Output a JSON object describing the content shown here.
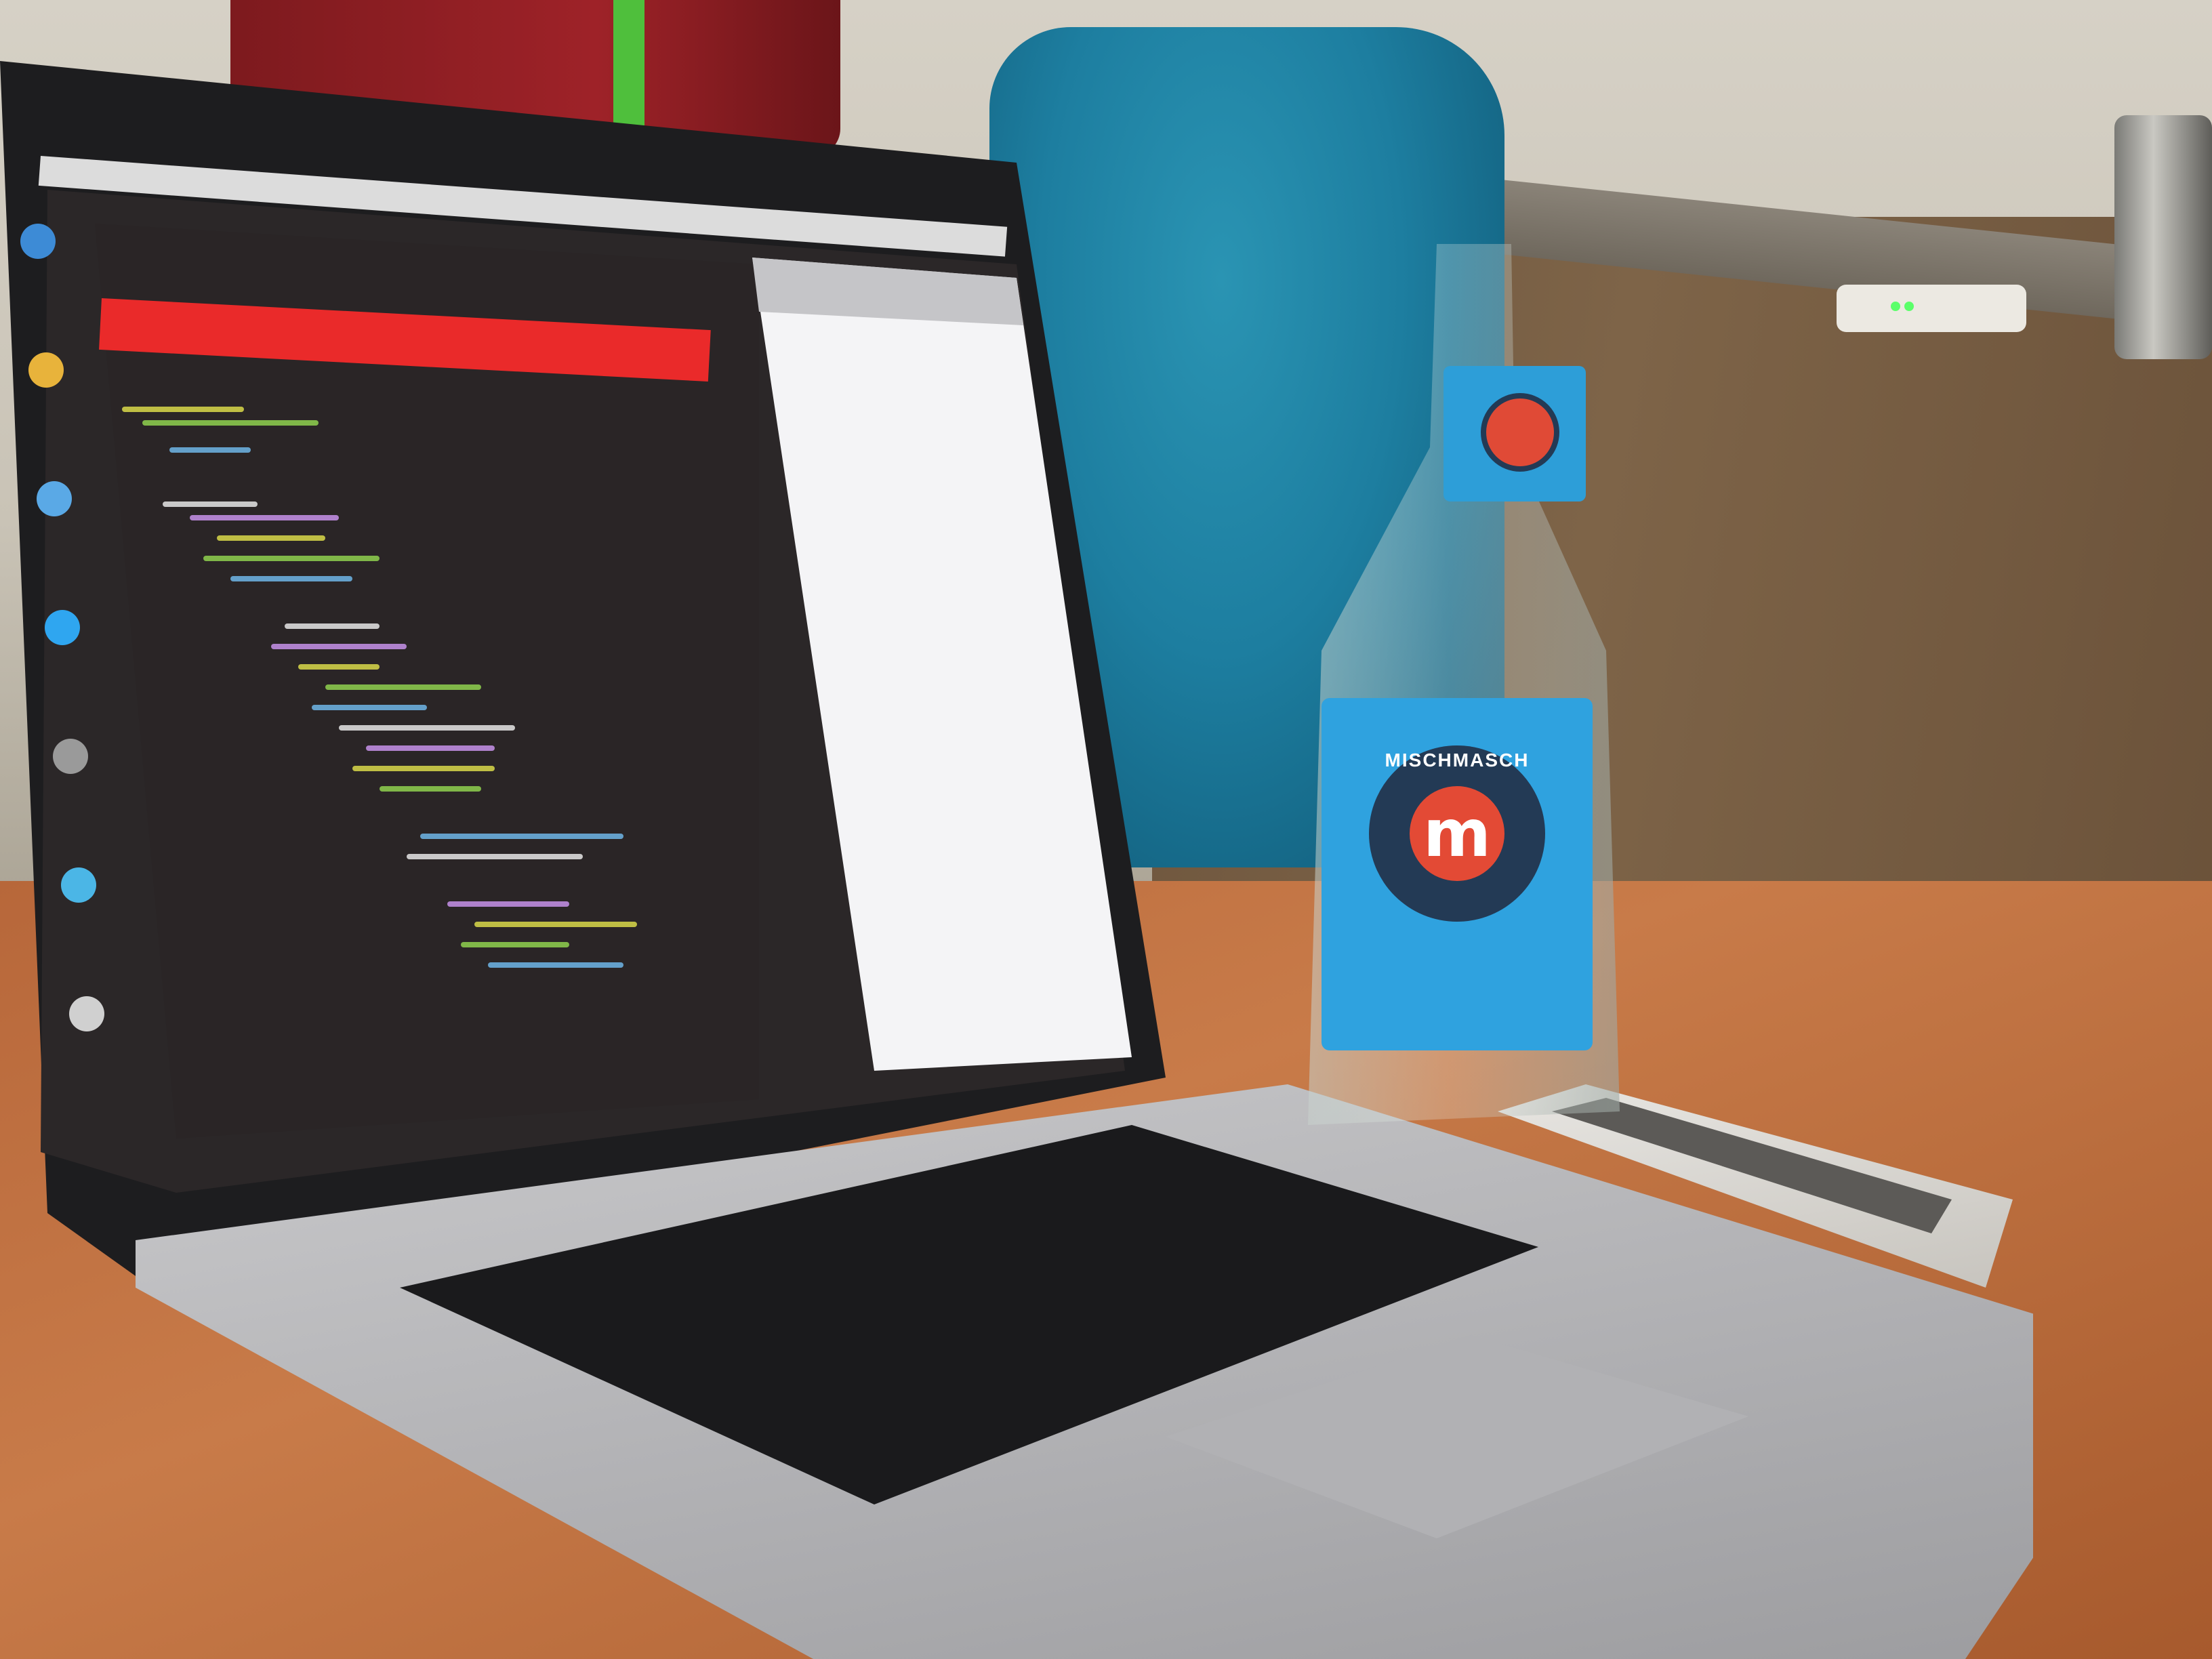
{
  "scene": {
    "bottle_label": {
      "brand": "MISCHMASCH",
      "logo_letter": "m"
    },
    "icons": [
      "finder-icon",
      "chrome-icon",
      "mail-icon",
      "twitter-icon",
      "settings-icon",
      "safari-icon",
      "trash-icon"
    ],
    "colors": {
      "wall": "#d6d1c6",
      "desk": "#c87b49",
      "editor_background": "#2a2526",
      "error_highlight": "#ea2a2a",
      "bottle_label": "#2fa2df",
      "bag": "#1d7ea0"
    }
  }
}
